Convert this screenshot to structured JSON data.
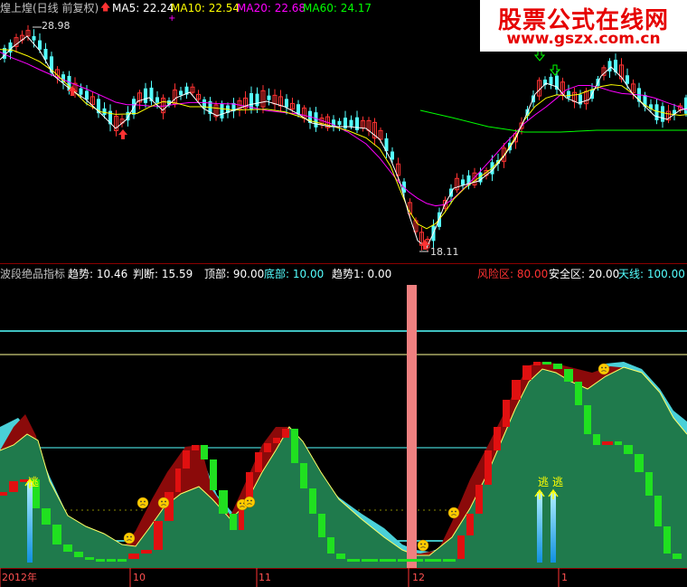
{
  "header": {
    "stock_title": "煌上煌(日线 前复权)",
    "ma5_label": "MA5: 22.24",
    "ma10_label": "MA10: 22.54",
    "ma20_label": "MA20: 22.68",
    "ma60_label": "MA60: 24.17",
    "colors": {
      "ma5": "#ffffff",
      "ma10": "#ffff00",
      "ma20": "#ff00ff",
      "ma60": "#00ff00",
      "up": "#ff3232",
      "down": "#54ffff"
    }
  },
  "price_panel": {
    "high_label": "28.98",
    "low_label": "18.11",
    "marks": {
      "plus": "+",
      "up_arrows": [
        "red-up-arrow",
        "red-up-arrow",
        "red-up-arrow"
      ],
      "down_arrows": [
        "green-down-arrow",
        "green-down-arrow"
      ]
    }
  },
  "indicator_header": {
    "name": "波段绝品指标",
    "trend_label": "趋势: 10.46",
    "judge_label": "判断: 15.59",
    "top_label": "顶部: 90.00",
    "bottom_label": "底部: 10.00",
    "trend1_label": "趋势1: 0.00",
    "risk_label": "风险区: 80.00",
    "safe_label": "安全区: 20.00",
    "sky_label": "天线: 100.00"
  },
  "indicator_panel": {
    "escape_labels": [
      "逃",
      "逃",
      "逃"
    ],
    "smiley_count": 10
  },
  "time_axis": {
    "labels": [
      "2012年",
      "10",
      "11",
      "12",
      "1"
    ]
  },
  "watermark": {
    "line1": "股票公式在线网",
    "line2": "www.gszx.com.cn"
  }
}
